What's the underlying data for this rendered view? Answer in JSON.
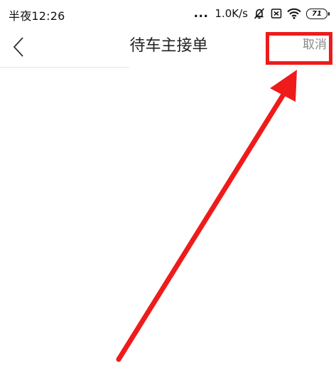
{
  "status_bar": {
    "time": "半夜12:26",
    "dots": "...",
    "network_speed": "1.0K/s",
    "battery_level": "71",
    "icons": [
      "mute-bell-icon",
      "sim-off-icon",
      "wifi-icon",
      "battery-icon"
    ]
  },
  "nav_bar": {
    "title": "待车主接单",
    "back_icon": "chevron-left-icon",
    "cancel_label": "取消"
  },
  "annotation": {
    "highlight_color": "#ef1b1b",
    "target": "cancel-button"
  }
}
